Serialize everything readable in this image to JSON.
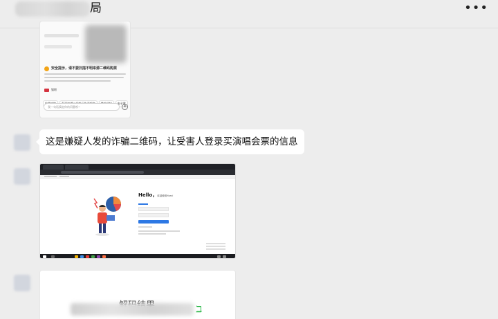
{
  "header": {
    "title_suffix": "局",
    "more_glyph": "•••"
  },
  "card1": {
    "warning_title": "安全提示，请不要扫描不明来源二维码购票",
    "brand_name": "猫眼",
    "chips": [
      "抢票攻略",
      "TF家族第三届练习生演唱会",
      "看前须知",
      "电子票"
    ],
    "input_placeholder": "我一句话搞定你的问题呗~",
    "send_glyph": "⊕"
  },
  "message": {
    "text": "这是嫌疑人发的诈骗二维码，让受害人登录买演唱会票的信息"
  },
  "card2": {
    "hello": "Hello，",
    "hello_sub": "欢迎使用Yuexi"
  },
  "card3": {
    "title": "解码结果",
    "icon_glyph": "ℶ"
  },
  "colors": {
    "warning": "#f2a417",
    "brand": "#d4323e",
    "primary_blue": "#2d78e4",
    "decode_green": "#2fb84b"
  }
}
